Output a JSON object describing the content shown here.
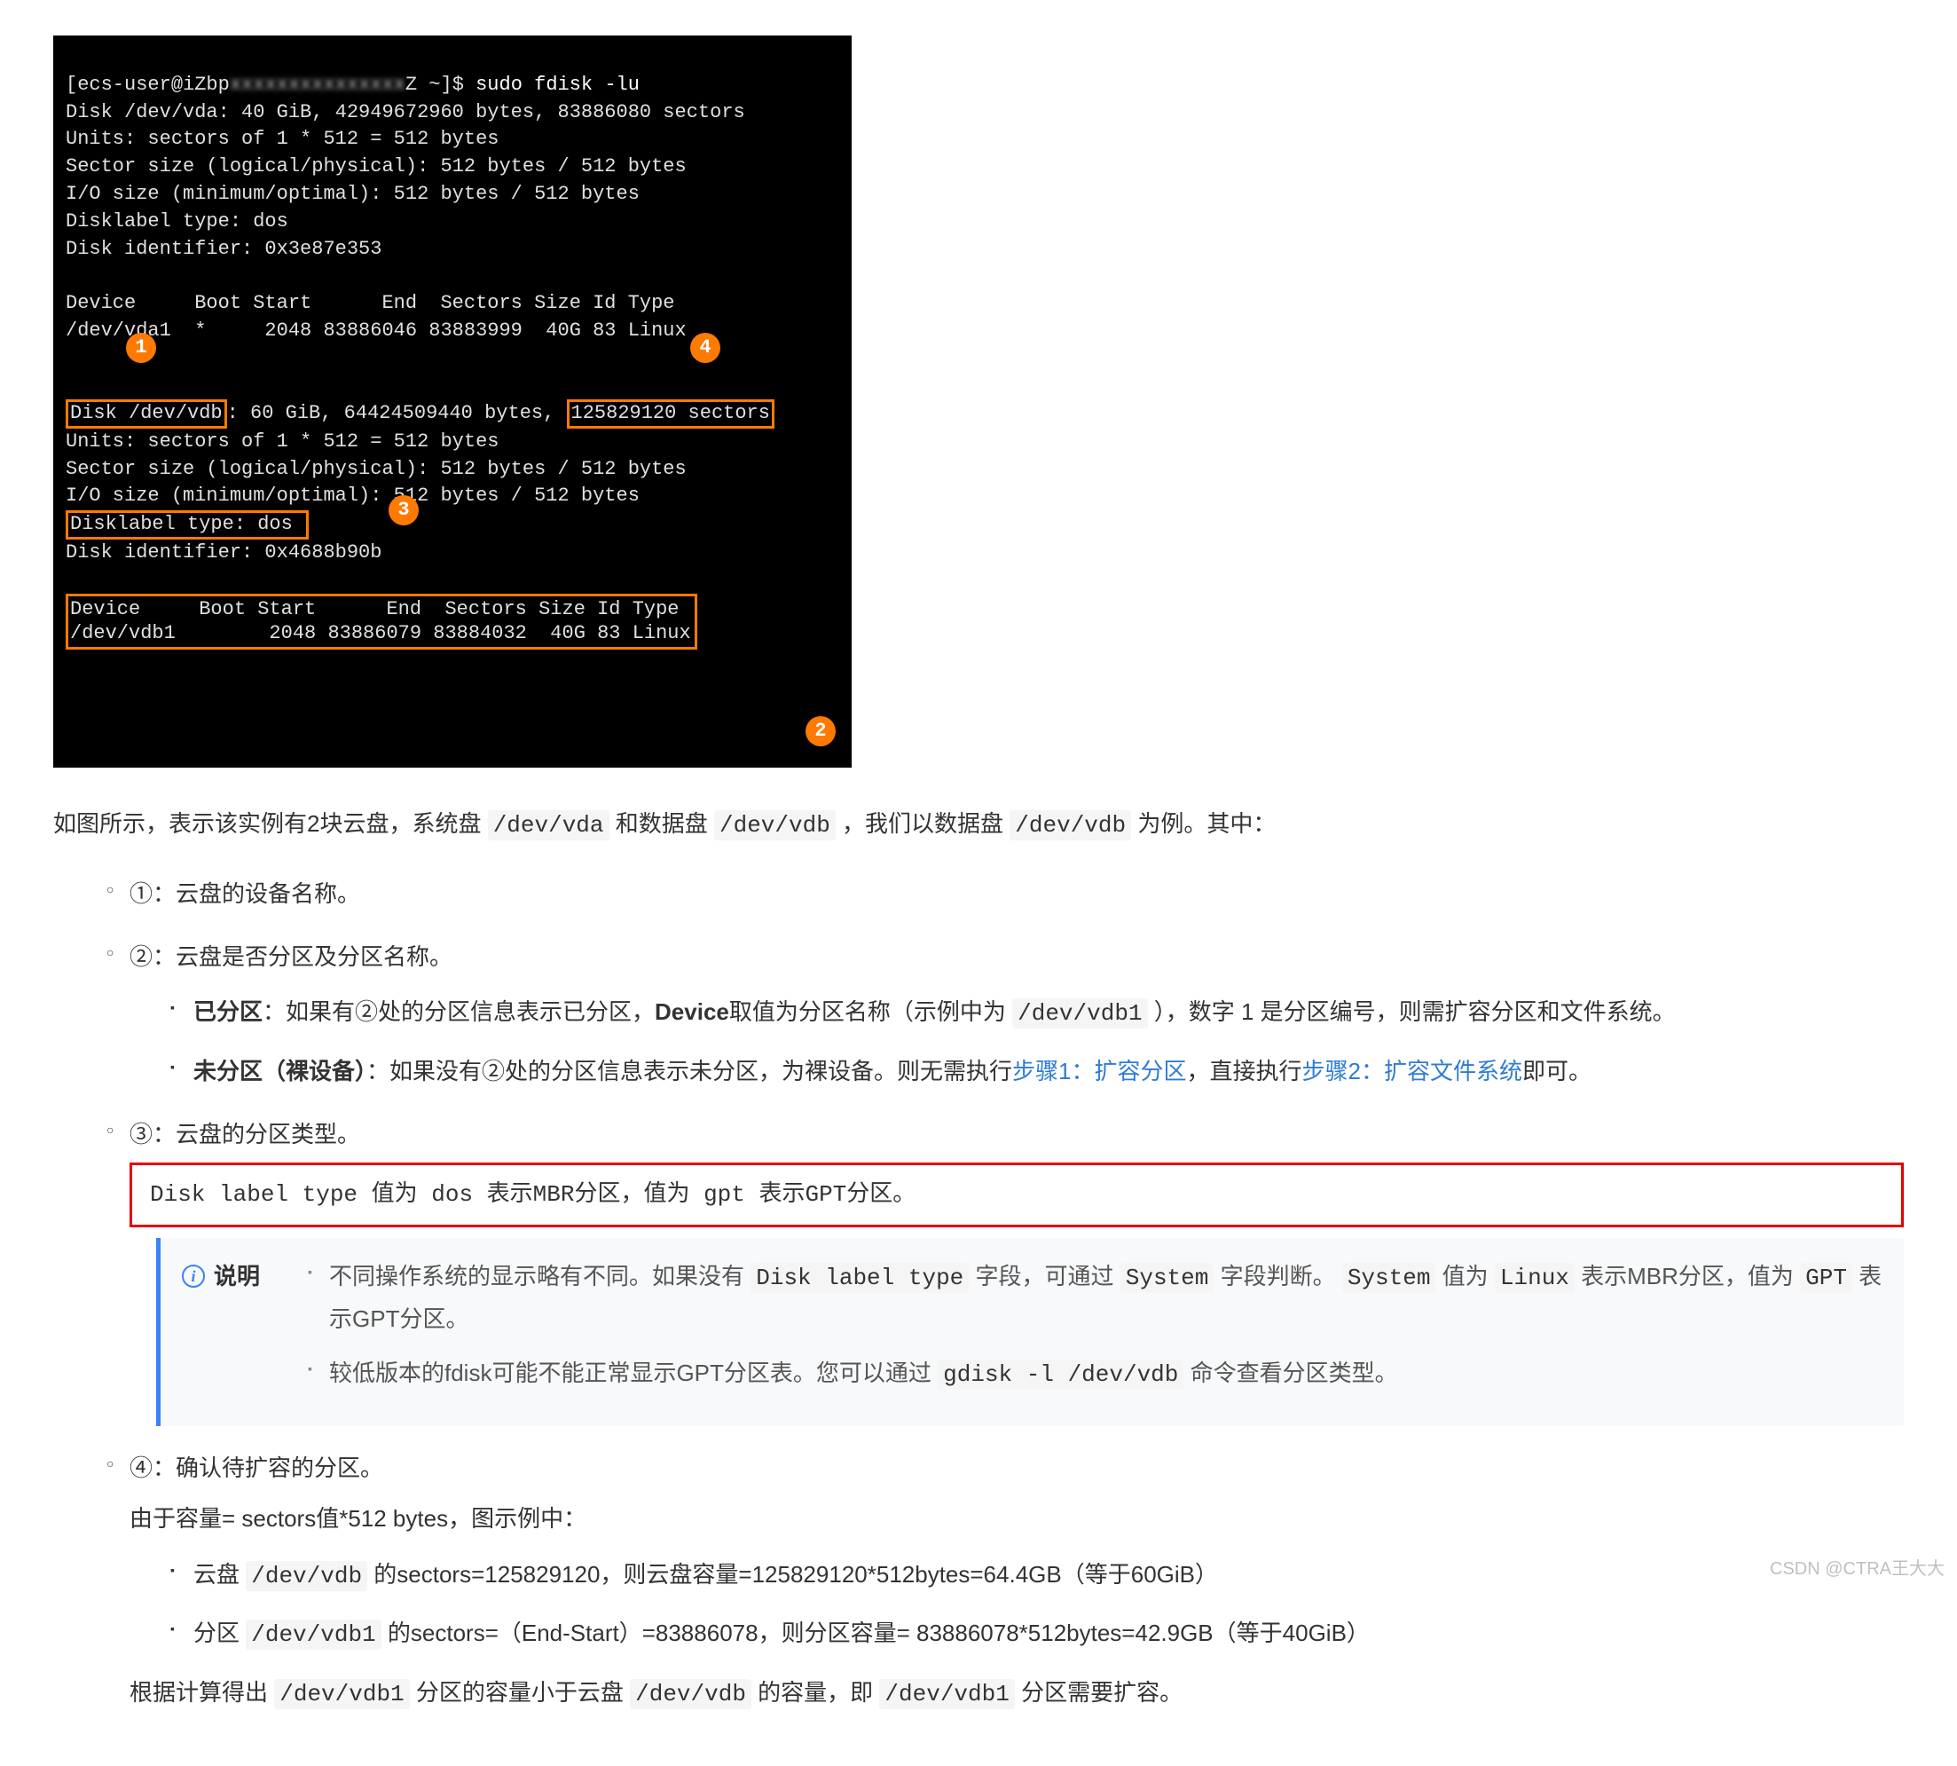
{
  "terminal": {
    "prompt_user": "[ecs-user@iZbp",
    "prompt_suffix": "Z ~]$ ",
    "command": "sudo fdisk -lu",
    "vda_line": "Disk /dev/vda: 40 GiB, 42949672960 bytes, 83886080 sectors",
    "units": "Units: sectors of 1 * 512 = 512 bytes",
    "sector_size": "Sector size (logical/physical): 512 bytes / 512 bytes",
    "io_size": "I/O size (minimum/optimal): 512 bytes / 512 bytes",
    "disklabel_dos": "Disklabel type: dos",
    "disk_id_a": "Disk identifier: 0x3e87e353",
    "header": "Device     Boot Start      End  Sectors Size Id Type",
    "vda1_row": "/dev/vda1  *     2048 83886046 83883999  40G 83 Linux",
    "vdb_prefix": "Disk /dev/vdb",
    "vdb_mid": ": 60 GiB, 64424509440 bytes, ",
    "vdb_sectors": "125829120 sectors",
    "disklabel_dos2": "Disklabel type: dos ",
    "disk_id_b": "Disk identifier: 0x4688b90b",
    "vdb_header": "Device     Boot Start      End  Sectors Size Id Type",
    "vdb1_row": "/dev/vdb1        2048 83886079 83884032  40G 83 Linux",
    "badge1": "1",
    "badge2": "2",
    "badge3": "3",
    "badge4": "4"
  },
  "text": {
    "intro_a": "如图所示，表示该实例有2块云盘，系统盘 ",
    "intro_vda": "/dev/vda",
    "intro_b": " 和数据盘 ",
    "intro_vdb": "/dev/vdb",
    "intro_c": " ，我们以数据盘 ",
    "intro_d": " 为例。其中：",
    "li1": "①：云盘的设备名称。",
    "li2": "②：云盘是否分区及分区名称。",
    "li2a_bold": "已分区",
    "li2a_rest_a": "：如果有②处的分区信息表示已分区，",
    "li2a_device": "Device",
    "li2a_rest_b": "取值为分区名称（示例中为 ",
    "li2a_code": "/dev/vdb1",
    "li2a_rest_c": " ），数字 1 是分区编号，则需扩容分区和文件系统。",
    "li2b_bold": "未分区（裸设备）",
    "li2b_rest_a": "：如果没有②处的分区信息表示未分区，为裸设备。则无需执行",
    "li2b_link1": "步骤1：扩容分区",
    "li2b_rest_b": "，直接执行",
    "li2b_link2": "步骤2：扩容文件系统",
    "li2b_rest_c": "即可。",
    "li3": "③：云盘的分区类型。",
    "redbox": "Disk label type 值为 dos 表示MBR分区，值为 gpt 表示GPT分区。",
    "note_title": "说明",
    "note1_a": "不同操作系统的显示略有不同。如果没有 ",
    "note1_code1": "Disk label type",
    "note1_b": " 字段，可通过 ",
    "note1_code2": "System",
    "note1_c": " 字段判断。 ",
    "note1_code3": "System",
    "note1_d": " 值为 ",
    "note1_code4": "Linux",
    "note1_e": " 表示MBR分区，值为 ",
    "note1_code5": "GPT",
    "note1_f": " 表示GPT分区。",
    "note2_a": "较低版本的fdisk可能不能正常显示GPT分区表。您可以通过 ",
    "note2_code": "gdisk -l /dev/vdb",
    "note2_b": " 命令查看分区类型。",
    "li4": "④：确认待扩容的分区。",
    "li4_sub": "由于容量= sectors值*512 bytes，图示例中：",
    "li4a_a": "云盘 ",
    "li4a_code": "/dev/vdb",
    "li4a_b": " 的sectors=125829120，则云盘容量=125829120*512bytes=64.4GB（等于60GiB）",
    "li4b_a": "分区 ",
    "li4b_code": "/dev/vdb1",
    "li4b_b": " 的sectors=（End-Start）=83886078，则分区容量= 83886078*512bytes=42.9GB（等于40GiB）",
    "conclusion_a": "根据计算得出 ",
    "conclusion_code1": "/dev/vdb1",
    "conclusion_b": " 分区的容量小于云盘 ",
    "conclusion_code2": "/dev/vdb",
    "conclusion_c": " 的容量，即 ",
    "conclusion_code3": "/dev/vdb1",
    "conclusion_d": " 分区需要扩容。",
    "watermark": "CSDN @CTRA王大大"
  }
}
